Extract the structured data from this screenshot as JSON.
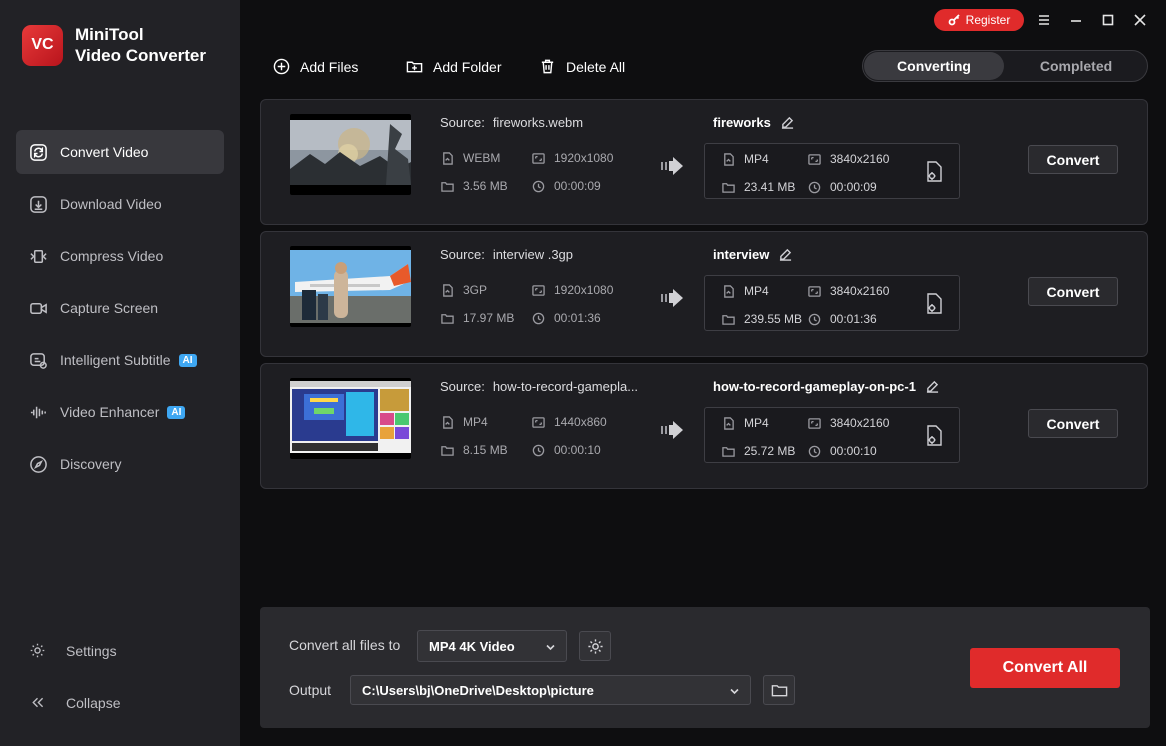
{
  "app": {
    "name_line1": "MiniTool",
    "name_line2": "Video Converter",
    "logo_text": "VC"
  },
  "sidebar": {
    "items": [
      {
        "label": "Convert Video",
        "icon": "convert-icon",
        "active": true
      },
      {
        "label": "Download Video",
        "icon": "download-icon"
      },
      {
        "label": "Compress Video",
        "icon": "compress-icon"
      },
      {
        "label": "Capture Screen",
        "icon": "camera-icon"
      },
      {
        "label": "Intelligent Subtitle",
        "icon": "subtitle-icon",
        "badge": "AI"
      },
      {
        "label": "Video Enhancer",
        "icon": "enhancer-icon",
        "badge": "AI"
      },
      {
        "label": "Discovery",
        "icon": "compass-icon"
      }
    ],
    "settings_label": "Settings",
    "collapse_label": "Collapse"
  },
  "titlebar": {
    "register_label": "Register"
  },
  "toolbar": {
    "add_files": "Add Files",
    "add_folder": "Add Folder",
    "delete_all": "Delete All"
  },
  "tabs": {
    "converting": "Converting",
    "completed": "Completed"
  },
  "files": [
    {
      "source_label": "Source:",
      "source_name": "fireworks.webm",
      "format": "WEBM",
      "resolution": "1920x1080",
      "size": "3.56 MB",
      "duration": "00:00:09",
      "output_name": "fireworks",
      "out_format": "MP4",
      "out_resolution": "3840x2160",
      "out_size": "23.41 MB",
      "out_duration": "00:00:09",
      "convert_label": "Convert"
    },
    {
      "source_label": "Source:",
      "source_name": "interview .3gp",
      "format": "3GP",
      "resolution": "1920x1080",
      "size": "17.97 MB",
      "duration": "00:01:36",
      "output_name": "interview",
      "out_format": "MP4",
      "out_resolution": "3840x2160",
      "out_size": "239.55 MB",
      "out_duration": "00:01:36",
      "convert_label": "Convert"
    },
    {
      "source_label": "Source:",
      "source_name": "how-to-record-gamepla...",
      "format": "MP4",
      "resolution": "1440x860",
      "size": "8.15 MB",
      "duration": "00:00:10",
      "output_name": "how-to-record-gameplay-on-pc-1",
      "out_format": "MP4",
      "out_resolution": "3840x2160",
      "out_size": "25.72 MB",
      "out_duration": "00:00:10",
      "convert_label": "Convert"
    }
  ],
  "bottom": {
    "convert_all_to_label": "Convert all files to",
    "format_value": "MP4 4K Video",
    "output_label": "Output",
    "output_path": "C:\\Users\\bj\\OneDrive\\Desktop\\picture",
    "convert_all_label": "Convert All"
  },
  "colors": {
    "accent": "#e02b2b",
    "ai_badge": "#3ea7f2"
  }
}
